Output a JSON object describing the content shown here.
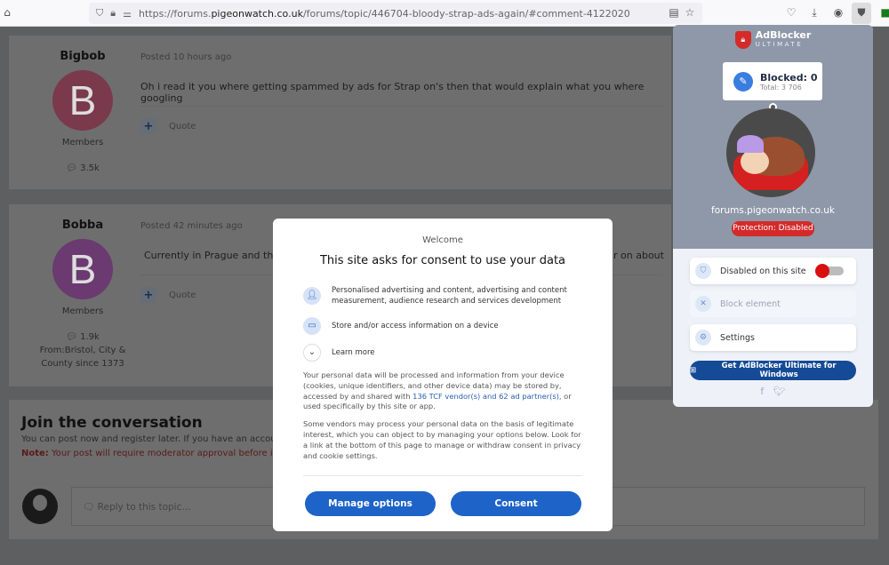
{
  "browser": {
    "url_prefix": "https://forums.",
    "url_host": "pigeonwatch.co.uk",
    "url_path": "/forums/topic/446704-bloody-strap-ads-again/#comment-4122020"
  },
  "posts": [
    {
      "author": "Bigbob",
      "initial": "B",
      "avatar_color": "#7a3a4c",
      "group": "Members",
      "count": "3.5k",
      "location": "",
      "posted": "Posted 10 hours ago",
      "text": "Oh i read it you where getting spammed by ads for Strap on's then that would explain what you where googling",
      "quote": "Quote"
    },
    {
      "author": "Bobba",
      "initial": "B",
      "avatar_color": "#6a3a70",
      "group": "Members",
      "count": "1.9k",
      "location": "From:Bristol, City & County since 1373",
      "posted": "Posted 42 minutes ago",
      "text": "Currently in Prague and the A",
      "text_tail": "r on about",
      "quote": "Quote"
    }
  ],
  "join": {
    "title": "Join the conversation",
    "line1": "You can post now and register later. If you have an accou",
    "note_label": "Note:",
    "note": " Your post will require moderator approval before it",
    "reply_placeholder": "Reply to this topic..."
  },
  "consent": {
    "welcome": "Welcome",
    "title": "This site asks for consent to use your data",
    "purposes": [
      "Personalised advertising and content, advertising and content measurement, audience research and services development",
      "Store and/or access information on a device"
    ],
    "learn_more": "Learn more",
    "para1_a": "Your personal data will be processed and information from your device (cookies, unique identifiers, and other device data) may be stored by, accessed by and shared with ",
    "para1_link": "136 TCF vendor(s) and 62 ad partner(s)",
    "para1_b": ", or used specifically by this site or app.",
    "para2": "Some vendors may process your personal data on the basis of legitimate interest, which you can object to by managing your options below. Look for a link at the bottom of this page to manage or withdraw consent in privacy and cookie settings.",
    "manage_label": "Manage options",
    "consent_label": "Consent",
    "accent": "#1e63c8"
  },
  "adblocker": {
    "brand": "AdBlocker",
    "brand_sub": "ULTIMATE",
    "blocked": "Blocked: 0",
    "total": "Total: 3 706",
    "domain": "forums.pigeonwatch.co.uk",
    "status": "Protection: Disabled",
    "items": [
      "Disabled on this site",
      "Block element",
      "Settings"
    ],
    "toggle_on": false,
    "windows_label": "Get AdBlocker Ultimate for Windows"
  }
}
